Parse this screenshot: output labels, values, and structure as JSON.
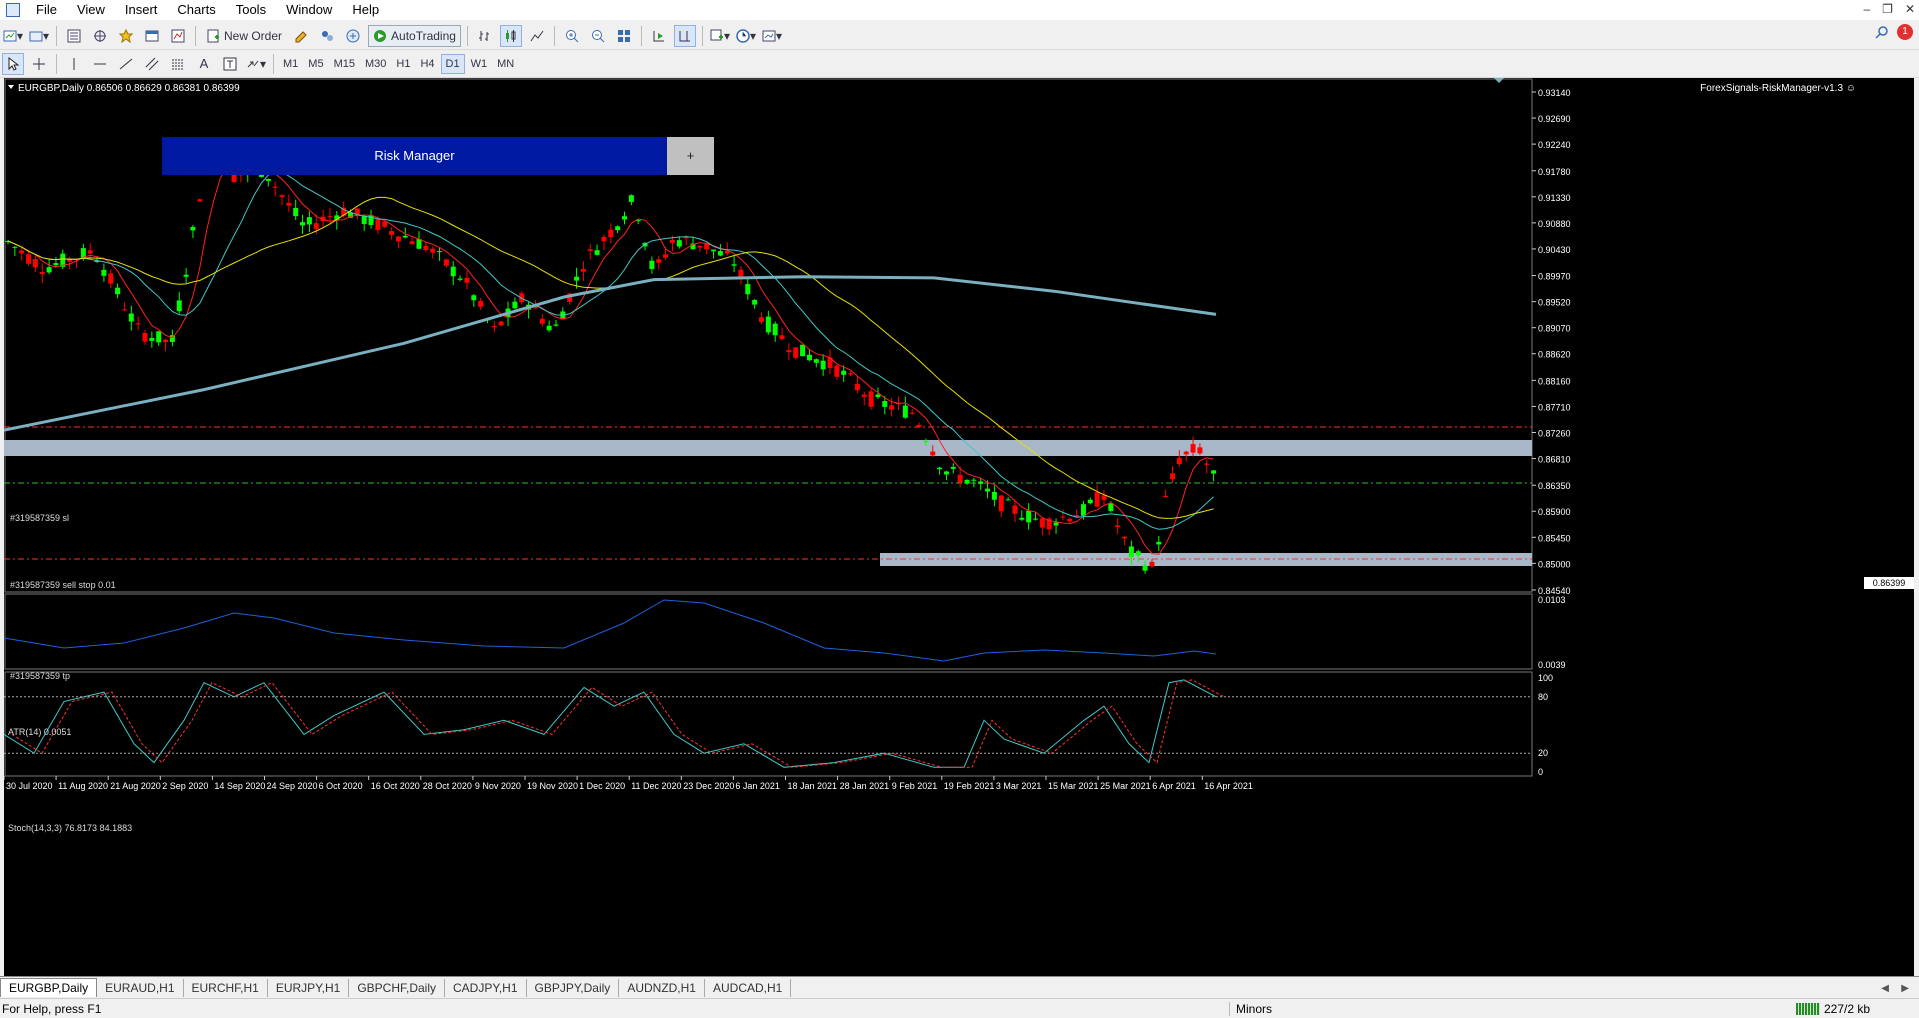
{
  "menu": [
    "File",
    "View",
    "Insert",
    "Charts",
    "Tools",
    "Window",
    "Help"
  ],
  "toolbar": {
    "new_order": "New Order",
    "auto_trading": "AutoTrading"
  },
  "timeframes": [
    "M1",
    "M5",
    "M15",
    "M30",
    "H1",
    "H4",
    "D1",
    "W1",
    "MN"
  ],
  "active_timeframe": "D1",
  "chart": {
    "header": "EURGBP,Daily  0.86506 0.86629 0.86381 0.86399",
    "ea_label": "ForexSignals-RiskManager-v1.3 ☺",
    "current_price": "0.86399",
    "price_ticks": [
      "0.93140",
      "0.92690",
      "0.92240",
      "0.91780",
      "0.91330",
      "0.90880",
      "0.90430",
      "0.89970",
      "0.89520",
      "0.89070",
      "0.88620",
      "0.88160",
      "0.87710",
      "0.87260",
      "0.86810",
      "0.86350",
      "0.85900",
      "0.85450",
      "0.85000",
      "0.84540"
    ],
    "date_ticks": [
      "30 Jul 2020",
      "11 Aug 2020",
      "21 Aug 2020",
      "2 Sep 2020",
      "14 Sep 2020",
      "24 Sep 2020",
      "6 Oct 2020",
      "16 Oct 2020",
      "28 Oct 2020",
      "9 Nov 2020",
      "19 Nov 2020",
      "1 Dec 2020",
      "11 Dec 2020",
      "23 Dec 2020",
      "6 Jan 2021",
      "18 Jan 2021",
      "28 Jan 2021",
      "9 Feb 2021",
      "19 Feb 2021",
      "3 Mar 2021",
      "15 Mar 2021",
      "25 Mar 2021",
      "6 Apr 2021",
      "16 Apr 2021"
    ],
    "order_sl": "#319587359 sl",
    "order_entry": "#319587359 sell stop 0.01",
    "order_tp": "#319587359 tp",
    "atr_label": "ATR(14) 0.0051",
    "atr_ticks": [
      "0.0103",
      "0.0039"
    ],
    "stoch_label": "Stoch(14,3,3) 76.8173 84.1883",
    "stoch_ticks": [
      "100",
      "80",
      "20",
      "0"
    ]
  },
  "risk_manager": {
    "title": "Risk Manager",
    "plus": "+"
  },
  "tabs": [
    "EURGBP,Daily",
    "EURAUD,H1",
    "EURCHF,H1",
    "EURJPY,H1",
    "GBPCHF,Daily",
    "CADJPY,H1",
    "GBPJPY,Daily",
    "AUDNZD,H1",
    "AUDCAD,H1"
  ],
  "active_tab": "EURGBP,Daily",
  "status": {
    "help": "For Help, press F1",
    "profile": "Minors",
    "traffic": "227/2 kb"
  },
  "colors": {
    "bull": "#00ff00",
    "bear": "#ff0000",
    "ma_fast": "#ff2020",
    "ma_mid": "#40c8c8",
    "ma_slow": "#e8e000",
    "ma_200": "#7ab0c0",
    "zone": "#a8b8c8"
  }
}
